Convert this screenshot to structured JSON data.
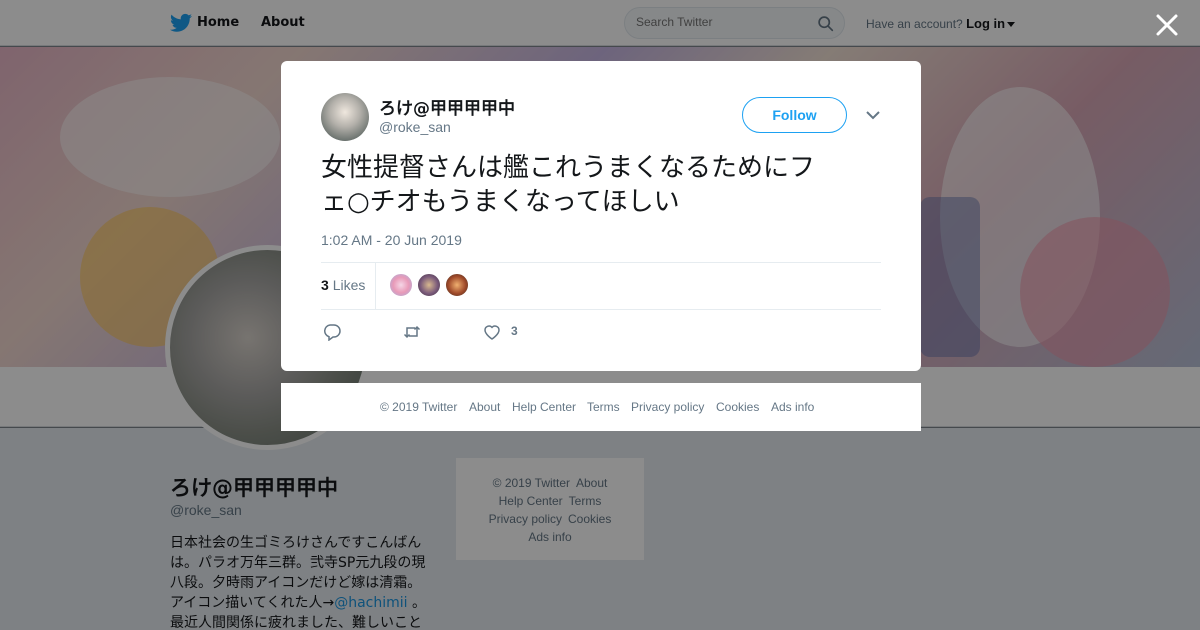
{
  "nav": {
    "home": "Home",
    "about": "About",
    "search_placeholder": "Search Twitter",
    "account_prompt": "Have an account?",
    "login": "Log in"
  },
  "profile": {
    "name": "ろけ@甲甲甲甲中",
    "handle": "@roke_san",
    "bio_line1": "日本社会の生ゴミろけさんですこんばん",
    "bio_line2": "は。パラオ万年三群。弐寺SP元九段の現",
    "bio_line3": "八段。夕時雨アイコンだけど嫁は清霜。",
    "bio_line4_pre": "アイコン描いてくれた人→",
    "bio_link": "@hachimii",
    "bio_line4_post": " 。",
    "bio_line5": "最近人間関係に疲れました、難しいこと"
  },
  "side_footer": {
    "copyright": "© 2019 Twitter",
    "about": "About",
    "help": "Help Center",
    "terms": "Terms",
    "privacy": "Privacy policy",
    "cookies": "Cookies",
    "ads": "Ads info"
  },
  "tweet": {
    "author_name": "ろけ@甲甲甲甲中",
    "author_handle": "@roke_san",
    "follow_label": "Follow",
    "text_line1": "女性提督さんは艦これうまくなるためにフ",
    "text_line2": "ェ○チオもうまくなってほしい",
    "timestamp": "1:02 AM - 20 Jun 2019",
    "likes_count": "3",
    "likes_label": "Likes",
    "like_action_count": "3"
  },
  "modal_footer": {
    "copyright": "© 2019 Twitter",
    "about": "About",
    "help": "Help Center",
    "terms": "Terms",
    "privacy": "Privacy policy",
    "cookies": "Cookies",
    "ads": "Ads info"
  },
  "colors": {
    "accent": "#1da1f2",
    "text": "#14171a",
    "muted": "#657786"
  }
}
